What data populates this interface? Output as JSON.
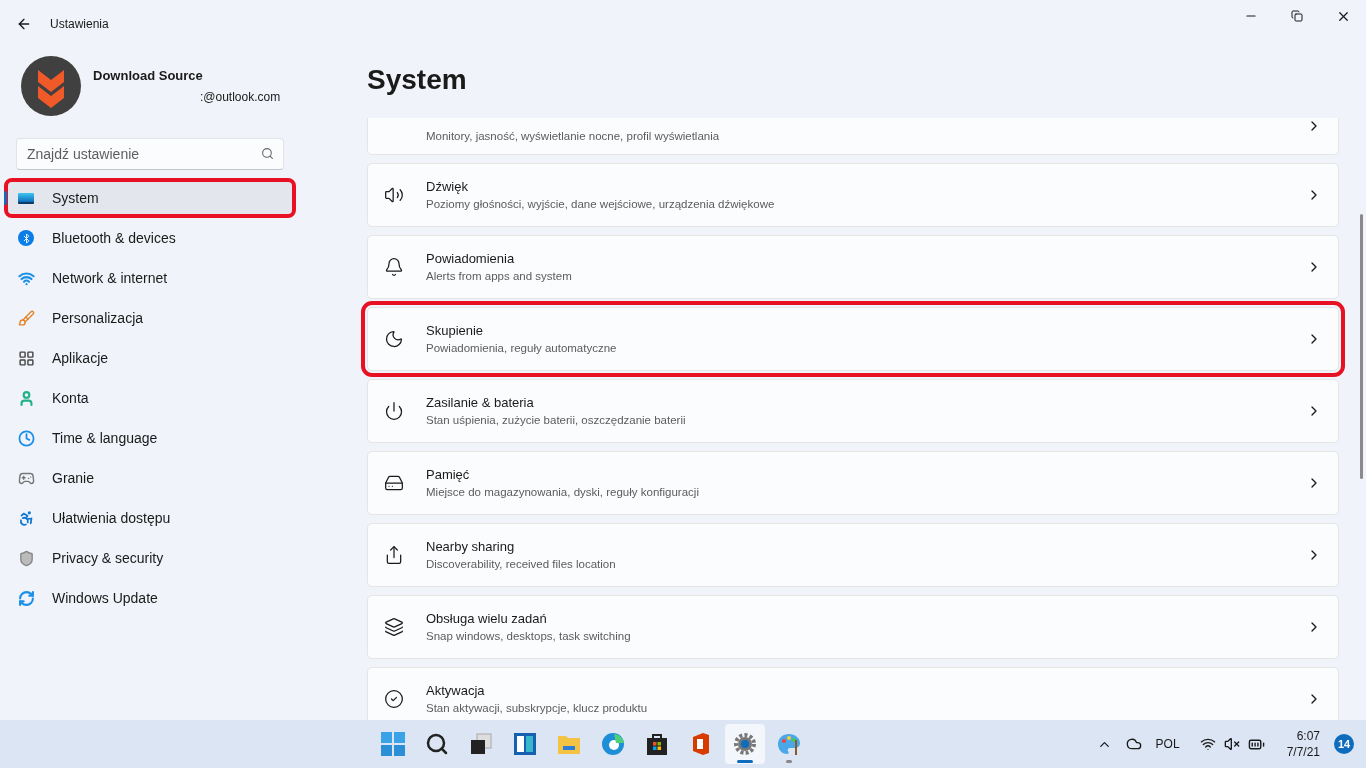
{
  "window": {
    "title": "Ustawienia"
  },
  "account": {
    "name": "Download Source",
    "email": ":@outlook.com"
  },
  "search": {
    "placeholder": "Znajdź ustawienie"
  },
  "nav": [
    {
      "label": "System",
      "selected": true,
      "highlighted": true
    },
    {
      "label": "Bluetooth & devices",
      "selected": false,
      "highlighted": false
    },
    {
      "label": "Network & internet",
      "selected": false,
      "highlighted": false
    },
    {
      "label": "Personalizacja",
      "selected": false,
      "highlighted": false
    },
    {
      "label": "Aplikacje",
      "selected": false,
      "highlighted": false
    },
    {
      "label": "Konta",
      "selected": false,
      "highlighted": false
    },
    {
      "label": "Time & language",
      "selected": false,
      "highlighted": false
    },
    {
      "label": "Granie",
      "selected": false,
      "highlighted": false
    },
    {
      "label": "Ułatwienia dostępu",
      "selected": false,
      "highlighted": false
    },
    {
      "label": "Privacy & security",
      "selected": false,
      "highlighted": false
    },
    {
      "label": "Windows Update",
      "selected": false,
      "highlighted": false
    }
  ],
  "page_title": "System",
  "cards": [
    {
      "subtitle": "Monitory, jasność, wyświetlanie nocne, profil wyświetlania",
      "highlighted": false
    },
    {
      "title": "Dźwięk",
      "subtitle": "Poziomy głośności, wyjście, dane wejściowe, urządzenia dźwiękowe",
      "highlighted": false
    },
    {
      "title": "Powiadomienia",
      "subtitle": "Alerts from apps and system",
      "highlighted": false
    },
    {
      "title": "Skupienie",
      "subtitle": "Powiadomienia, reguły automatyczne",
      "highlighted": true
    },
    {
      "title": "Zasilanie & bateria",
      "subtitle": "Stan uśpienia, zużycie baterii, oszczędzanie baterii",
      "highlighted": false
    },
    {
      "title": "Pamięć",
      "subtitle": "Miejsce do magazynowania, dyski, reguły konfiguracji",
      "highlighted": false
    },
    {
      "title": "Nearby sharing",
      "subtitle": "Discoverability, received files location",
      "highlighted": false
    },
    {
      "title": "Obsługa wielu zadań",
      "subtitle": "Snap windows, desktops, task switching",
      "highlighted": false
    },
    {
      "title": "Aktywacja",
      "subtitle": "Stan aktywacji, subskrypcje, klucz produktu",
      "highlighted": false
    }
  ],
  "taskbar": {
    "apps": [
      {
        "active": false,
        "running": false
      },
      {
        "active": false,
        "running": false
      },
      {
        "active": false,
        "running": false
      },
      {
        "active": false,
        "running": false
      },
      {
        "active": false,
        "running": false
      },
      {
        "active": false,
        "running": false
      },
      {
        "active": false,
        "running": false
      },
      {
        "active": false,
        "running": false
      },
      {
        "active": true,
        "running": true
      },
      {
        "active": false,
        "running": true
      }
    ],
    "language": "POL",
    "time": "6:07",
    "date": "7/7/21",
    "notifications": "14"
  }
}
